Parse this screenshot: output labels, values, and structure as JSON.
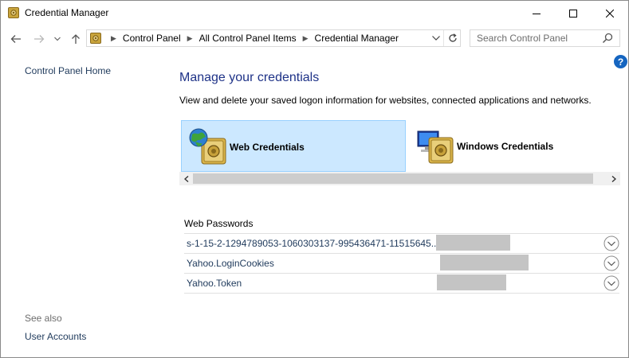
{
  "window": {
    "title": "Credential Manager",
    "app_icon": "credential-manager-icon"
  },
  "address_bar": {
    "crumbs": [
      "Control Panel",
      "All Control Panel Items",
      "Credential Manager"
    ]
  },
  "search": {
    "placeholder": "Search Control Panel"
  },
  "left_pane": {
    "home_link": "Control Panel Home",
    "see_also_label": "See also",
    "see_also_links": [
      "User Accounts"
    ]
  },
  "main": {
    "title": "Manage your credentials",
    "description": "View and delete your saved logon information for websites, connected applications and networks.",
    "tiles": [
      {
        "label": "Web Credentials",
        "selected": true,
        "icon": "web-credentials-icon"
      },
      {
        "label": "Windows Credentials",
        "selected": false,
        "icon": "windows-credentials-icon"
      }
    ],
    "section_title": "Web Passwords",
    "credentials": [
      {
        "name": "s-1-15-2-1294789053-1060303137-995436471-11515645..."
      },
      {
        "name": "Yahoo.LoginCookies"
      },
      {
        "name": "Yahoo.Token"
      }
    ]
  },
  "colors": {
    "link": "#1e395b",
    "title": "#1e3287",
    "selected_tile_bg": "#cce8ff",
    "selected_tile_border": "#99d1ff",
    "help_icon_bg": "#1565c0"
  }
}
